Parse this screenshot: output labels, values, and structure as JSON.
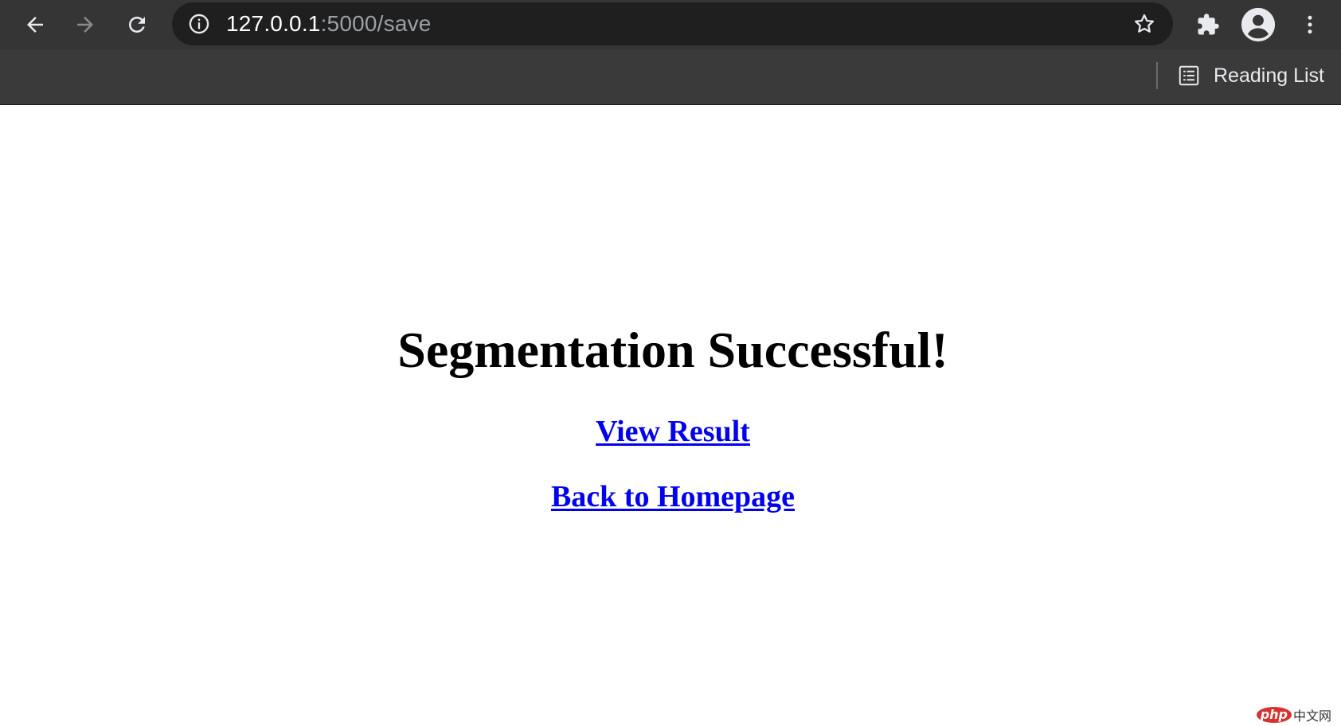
{
  "browser": {
    "url_host": "127.0.0.1",
    "url_path": ":5000/save",
    "reading_list_label": "Reading List",
    "icons": {
      "back": "back-arrow-icon",
      "forward": "forward-arrow-icon",
      "reload": "reload-icon",
      "info": "info-icon",
      "bookmark": "star-icon",
      "extensions": "puzzle-icon",
      "profile": "avatar-icon",
      "menu": "more-vert-icon",
      "reading_list": "reading-list-icon"
    },
    "colors": {
      "toolbar": "#353535",
      "omnibox": "#1f1f1f",
      "icon": "#e8eaed",
      "icon_disabled": "#8a8a8a"
    }
  },
  "page": {
    "title": "Segmentation Successful!",
    "view_result_link": "View Result",
    "back_home_link": "Back to Homepage",
    "link_color": "#0000ee"
  },
  "watermark": {
    "badge": "php",
    "text": "中文网"
  }
}
